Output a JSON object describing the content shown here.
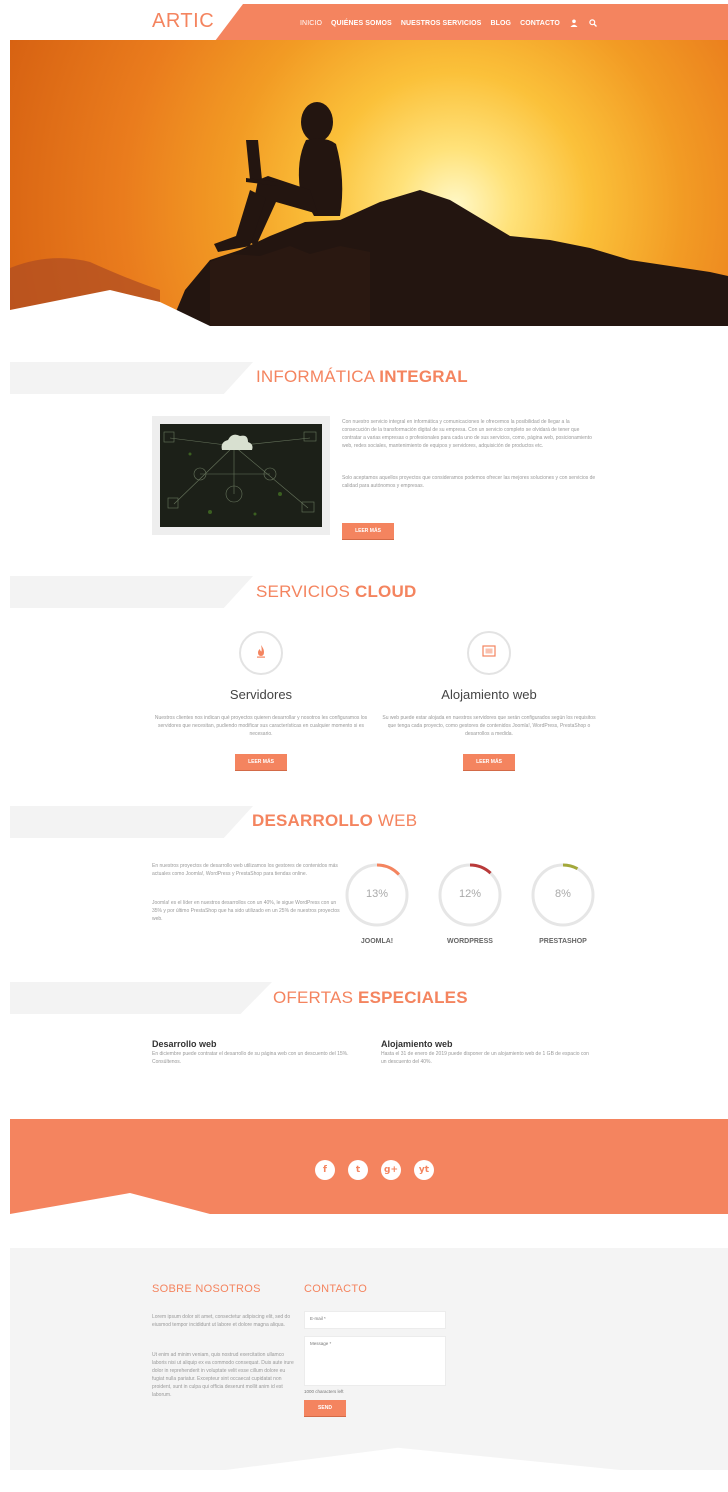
{
  "header": {
    "logo": "ARTIC",
    "nav": [
      "INICIO",
      "QUIÉNES SOMOS",
      "NUESTROS SERVICIOS",
      "BLOG",
      "CONTACTO"
    ],
    "icons": [
      "user-icon",
      "search-icon"
    ]
  },
  "colors": {
    "accent": "#f4845f",
    "light_gray": "#f3f3f3",
    "text": "#999999"
  },
  "informatica": {
    "title_light": "INFORMÁTICA ",
    "title_bold": "INTEGRAL",
    "para1": "Con nuestro servicio integral en informática y comunicaciones le ofrecemos la posibilidad de llegar a la consecución de la transformación digital de su empresa. Con un servicio completo se olvidará de tener que contratar a varias empresas o profesionales para cada uno de sus servicios, como, página web, posicionamiento web, redes sociales, mantenimiento de equipos y servidores, adquisición de productos etc.",
    "para2": "Solo aceptamos aquellos proyectos que consideramos podemos ofrecer las mejores soluciones y con servicios de calidad para autónomos y empresas.",
    "button": "LEER MÁS"
  },
  "servicios": {
    "title_light": "SERVICIOS ",
    "title_bold": "CLOUD",
    "items": [
      {
        "icon": "flame-icon",
        "title": "Servidores",
        "text": "Nuestros clientes nos indican qué proyectos quieren desarrollar y nosotros les configuramos los servidores que necesitan, pudiendo modificar sus características en cualquier momento si es necesario.",
        "button": "LEER MÁS"
      },
      {
        "icon": "window-icon",
        "title": "Alojamiento web",
        "text": "Su web puede estar alojada en nuestros servidores que serán configurados según los requisitos que tenga cada proyecto, como gestores de contenidos Joomla!, WordPress, PrestaShop o desarrollos a medida.",
        "button": "LEER MÁS"
      }
    ]
  },
  "desarrollo": {
    "title_bold": "DESARROLLO",
    "title_light": " WEB",
    "para1": "En nuestros proyectos de desarrollo web utilizamos los gestores de contenidos más actuales como Joomla!, WordPress y PrestaShop para tiendas online.",
    "para2": "Joomla! es el líder en nuestros desarrollos con un 40%, le sigue WordPress con un 35% y por último PrestaShop que ha sido utilizado en un 25% de nuestros proyectos web.",
    "donuts": [
      {
        "label": "JOOMLA!",
        "pct_text": "13%",
        "value": 13,
        "color": "#f4845f"
      },
      {
        "label": "WORDPRESS",
        "pct_text": "12%",
        "value": 12,
        "color": "#b93a3a"
      },
      {
        "label": "PRESTASHOP",
        "pct_text": "8%",
        "value": 8,
        "color": "#a3a83a"
      }
    ]
  },
  "ofertas": {
    "title_light": "OFERTAS ",
    "title_bold": "ESPECIALES",
    "items": [
      {
        "title": "Desarrollo web",
        "text": "En diciembre puede contratar el desarrollo de su página web con un descuento del 15%. Consúltenos."
      },
      {
        "title": "Alojamiento web",
        "text": "Hasta el 31 de enero de 2019 puede disponer de un alojamiento web de 1 GB de espacio con un descuento del 40%."
      }
    ]
  },
  "social": [
    "f",
    "t",
    "g+",
    "yt"
  ],
  "footer": {
    "about_title": "SOBRE NOSOTROS",
    "about_p1": "Lorem ipsum dolor sit amet, consectetur adipiscing elit, sed do eiusmod tempor incididunt ut labore et dolore magna aliqua.",
    "about_p2": "Ut enim ad minim veniam, quis nostrud exercitation ullamco laboris nisi ut aliquip ex ea commodo consequat. Duis aute irure dolor in reprehenderit in voluptate velit esse cillum dolore eu fugiat nulla pariatur. Excepteur sint occaecat cupidatat non proident, sunt in culpa qui officia deserunt mollit anim id est laborum.",
    "contact_title": "CONTACTO",
    "email_label": "E-mail *",
    "message_label": "Message *",
    "chars_left": "1000 characters left",
    "send_button": "SEND"
  }
}
